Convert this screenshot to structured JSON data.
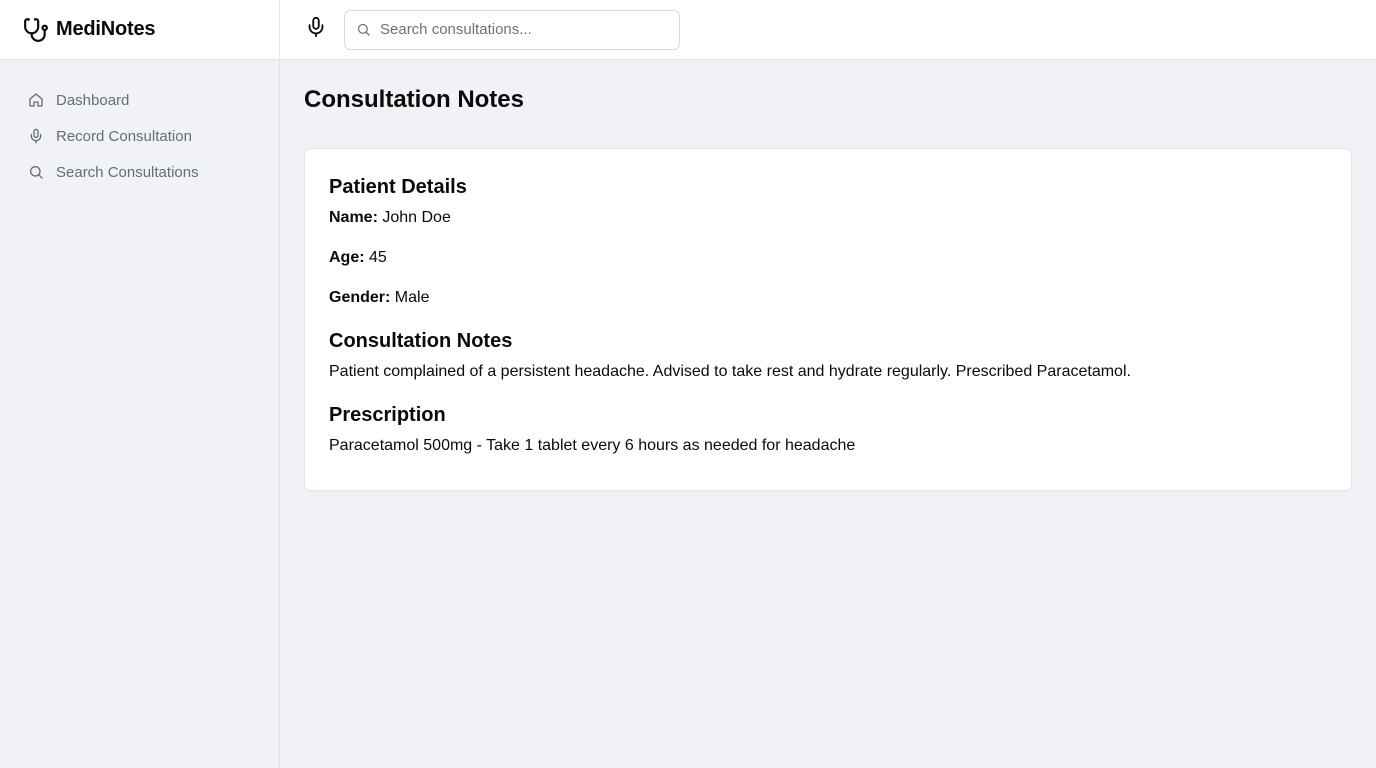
{
  "app": {
    "name": "MediNotes",
    "logo_icon": "stethoscope-icon"
  },
  "sidebar": {
    "items": [
      {
        "label": "Dashboard",
        "icon": "home-icon"
      },
      {
        "label": "Record Consultation",
        "icon": "mic-icon"
      },
      {
        "label": "Search Consultations",
        "icon": "search-icon"
      }
    ]
  },
  "topbar": {
    "mic_icon": "mic-icon",
    "search": {
      "placeholder": "Search consultations...",
      "value": ""
    }
  },
  "main": {
    "title": "Consultation Notes",
    "card": {
      "patient_heading": "Patient Details",
      "name_label": "Name:",
      "name_value": "John Doe",
      "age_label": "Age:",
      "age_value": "45",
      "gender_label": "Gender:",
      "gender_value": "Male",
      "notes_heading": "Consultation Notes",
      "notes_text": "Patient complained of a persistent headache. Advised to take rest and hydrate regularly. Prescribed Paracetamol.",
      "prescription_heading": "Prescription",
      "prescription_text": "Paracetamol 500mg - Take 1 tablet every 6 hours as needed for headache"
    }
  },
  "colors": {
    "background": "#f0f2f5",
    "surface": "#ffffff",
    "border": "#e3e5e8",
    "text": "#0a0a0a",
    "muted": "#666d78"
  }
}
